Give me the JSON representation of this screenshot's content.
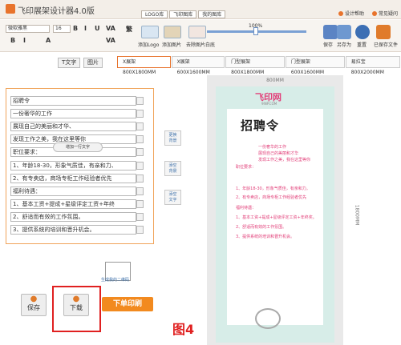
{
  "app": {
    "title": "飞印展架设计器4.0版"
  },
  "tabs": [
    "LOGO库",
    "飞印图库",
    "我的图库"
  ],
  "toplinks": [
    "设计帮助",
    "常见疑问"
  ],
  "toolbar": {
    "font": "微软雅黑",
    "size": "16",
    "buttons": [
      "B",
      "I",
      "U",
      "A",
      "VA",
      "VA",
      "繁"
    ],
    "tools": [
      "添加Logo",
      "添加图片",
      "去除图片白底"
    ],
    "zoom": "100%",
    "right": [
      "保存",
      "另存为",
      "重置",
      "已保存文件"
    ]
  },
  "modes": [
    "T文字",
    "图片"
  ],
  "sizes": [
    "X展架800X1800MM",
    "X展架600X1600MM",
    "门型展架800X1800MM",
    "门型展架600X1600MM",
    "易拉宝800X2000MM"
  ],
  "lines": [
    "招聘令",
    "一份奢华的工作",
    "展现自己的美丽和才华、",
    "发现工作之美，我在这里等你",
    "职位要求：",
    "1、年龄18-30，形象气质佳，有亲和力、",
    "2、有专卖店，商场专柜工作经验者优先",
    "福利待遇：",
    "1、基本工资+提成+星级评定工资+年终",
    "2、舒适而有效的工作氛围。",
    "3、提供系统的培训和晋升机会。"
  ],
  "addline": "增加一行文字",
  "side": [
    [
      "更换",
      "背景"
    ],
    [
      "添空",
      "背景"
    ],
    [
      "添空",
      "文字"
    ]
  ],
  "canvas": {
    "width_label": "800MM",
    "height_label": "1800MM",
    "brand": "飞印网",
    "brand_url": "9INP.COM",
    "title": "招聘令",
    "texts": [
      "一份奢华的工作",
      "展现自己的美丽和才华",
      "发现工作之美，我在这里等你",
      "职位要求：",
      "1、年龄18-30，形象气质佳，有亲和力。",
      "2、有专卖店，商场专柜工作经验者优先",
      "福利待遇：",
      "1、基本工资+提成+星级评定工资+年终奖。",
      "2、舒适而有效的工作氛围。",
      "3、提供系统的培训和晋升机会。"
    ]
  },
  "qr_caption": "生成我的二维码",
  "save": "保存",
  "download": "下载",
  "order": "下单印刷",
  "figure": "图4",
  "colors": {
    "accent": "#f28a1f",
    "highlight": "#e02020",
    "poster_text": "#e2407a"
  }
}
